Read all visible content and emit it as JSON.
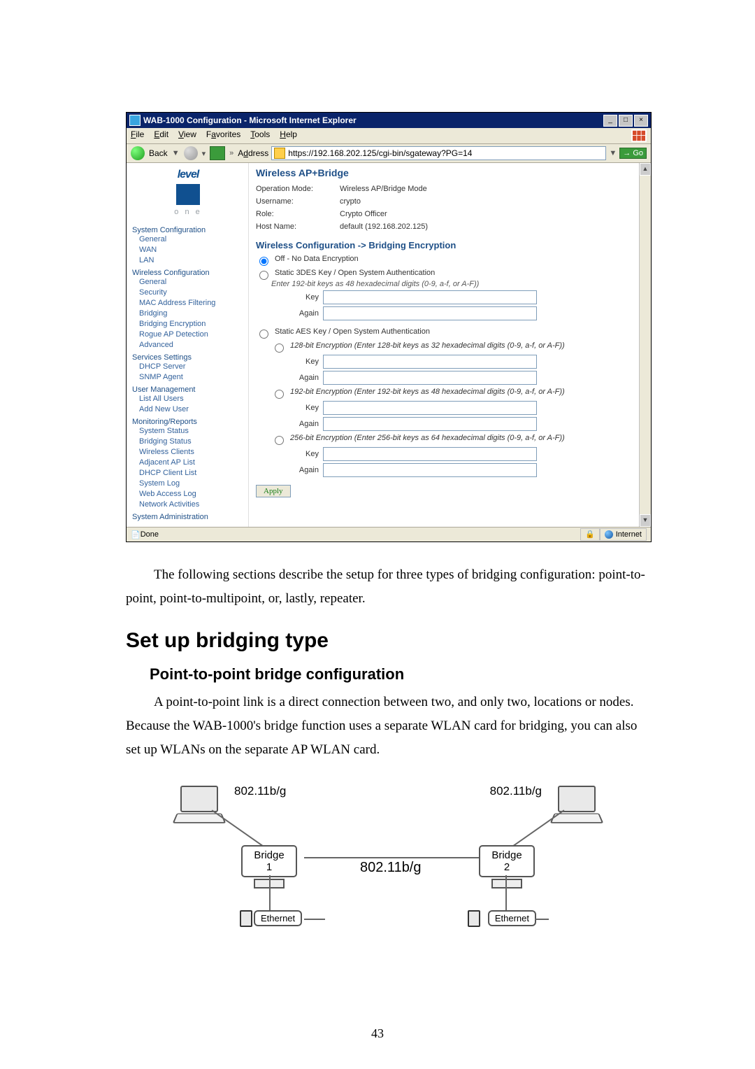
{
  "ie": {
    "title": "WAB-1000 Configuration - Microsoft Internet Explorer",
    "menu": {
      "file": "File",
      "edit": "Edit",
      "view": "View",
      "favorites": "Favorites",
      "tools": "Tools",
      "help": "Help"
    },
    "back_label": "Back",
    "address_label": "Address",
    "url": "https://192.168.202.125/cgi-bin/sgateway?PG=14",
    "go_label": "Go",
    "status_done": "Done",
    "status_zone": "Internet"
  },
  "brand": {
    "name": "level",
    "sub": "o n e"
  },
  "nav": {
    "g0": "System Configuration",
    "g0_items": [
      "General",
      "WAN",
      "LAN"
    ],
    "g1": "Wireless Configuration",
    "g1_items": [
      "General",
      "Security",
      "MAC Address Filtering",
      "Bridging",
      "Bridging Encryption",
      "Rogue AP Detection",
      "Advanced"
    ],
    "g2": "Services Settings",
    "g2_items": [
      "DHCP Server",
      "SNMP Agent"
    ],
    "g3": "User Management",
    "g3_items": [
      "List All Users",
      "Add New User"
    ],
    "g4": "Monitoring/Reports",
    "g4_items": [
      "System Status",
      "Bridging Status",
      "Wireless Clients",
      "Adjacent AP List",
      "DHCP Client List",
      "System Log",
      "Web Access Log",
      "Network Activities"
    ],
    "g5": "System Administration"
  },
  "panel": {
    "h1": "Wireless AP+Bridge",
    "rows": {
      "opmode_k": "Operation Mode:",
      "opmode_v": "Wireless AP/Bridge Mode",
      "user_k": "Username:",
      "user_v": "crypto",
      "role_k": "Role:",
      "role_v": "Crypto Officer",
      "host_k": "Host Name:",
      "host_v": "default (192.168.202.125)"
    },
    "h2": "Wireless Configuration -> Bridging Encryption",
    "opt_off": "Off - No Data Encryption",
    "opt_3des": "Static 3DES Key / Open System Authentication",
    "hint_3des": "Enter 192-bit keys as 48 hexadecimal digits (0-9, a-f, or A-F))",
    "opt_aes": "Static AES Key / Open System Authentication",
    "aes128": "128-bit Encryption (Enter 128-bit keys as 32 hexadecimal digits (0-9, a-f, or A-F))",
    "aes192": "192-bit Encryption (Enter 192-bit keys as 48 hexadecimal digits (0-9, a-f, or A-F))",
    "aes256": "256-bit Encryption (Enter 256-bit keys as 64 hexadecimal digits (0-9, a-f, or A-F))",
    "key_label": "Key",
    "again_label": "Again",
    "apply": "Apply"
  },
  "doc": {
    "para1": "The following sections describe the setup for three types of bridging configuration: point-to-point, point-to-multipoint, or, lastly, repeater.",
    "h1": "Set up bridging type",
    "h2": "Point-to-point bridge configuration",
    "para2": "A point-to-point link is a direct connection between two, and only two, locations or nodes. Because the WAB-1000's bridge function uses a separate WLAN card for bridging, you can also set up WLANs on the separate AP WLAN card.",
    "pagenum": "43"
  },
  "diagram": {
    "wlan_label_left": "802.11b/g",
    "wlan_label_mid": "802.11b/g",
    "wlan_label_right": "802.11b/g",
    "bridge1": "Bridge 1",
    "bridge2": "Bridge 2",
    "eth": "Ethernet"
  }
}
